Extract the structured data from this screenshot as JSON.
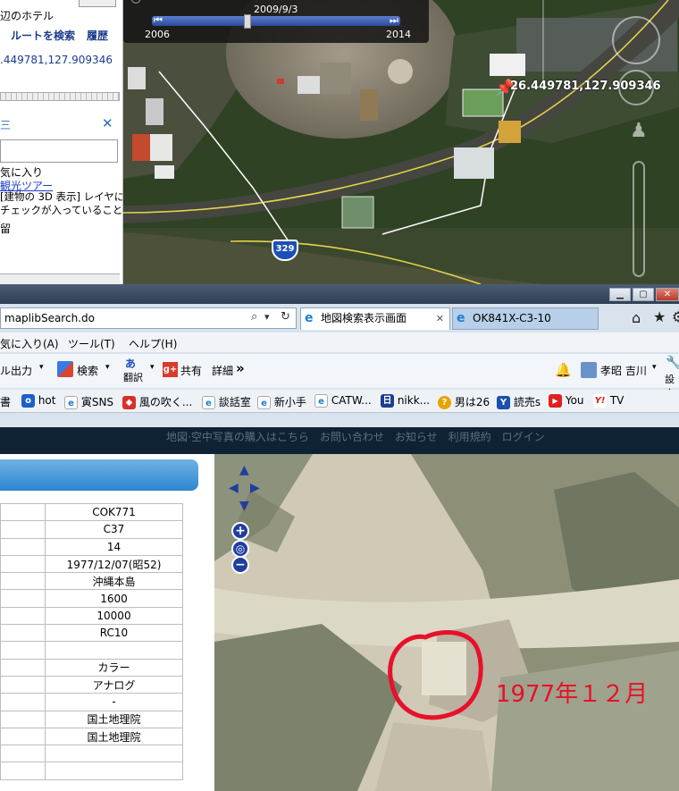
{
  "ge": {
    "sidebar_title": "辺のホテル",
    "route_search": "ルートを検索",
    "history": "履歴",
    "coords_text": ".449781,127.909346",
    "layers_heading": "気に入り",
    "tour_link": "観光ツアー",
    "note_line1": "[建物の 3D 表示] レイヤに",
    "note_line2": "チェックが入っていることを",
    "note_line3": "留",
    "time_date": "2009/9/3",
    "time_start": "2006",
    "time_end": "2014",
    "placemark_label": "26.449781,127.909346",
    "route_shield": "329"
  },
  "ie": {
    "address": "maplibSearch.do",
    "tabs": [
      {
        "label": "地図検索表示画面",
        "active": true
      },
      {
        "label": "OK841X-C3-10",
        "active": false
      }
    ],
    "menu": [
      "気に入り(A)",
      "ツール(T)",
      "ヘルプ(H)"
    ],
    "cmd": {
      "output": "ル出力",
      "search": "検索",
      "translate": "翻訳",
      "share": "共有",
      "detail": "詳細",
      "more": "»",
      "user": "孝昭 吉川",
      "settings": "設定"
    },
    "favorites": [
      "書",
      "hot",
      "寅SNS",
      "風の吹く...",
      "談話室",
      "新小手",
      "CATW...",
      "nikk...",
      "男は26",
      "読売s",
      "You",
      "TV"
    ]
  },
  "site": {
    "nav_text": "地図·空中写真の購入はこちら　お問い合わせ　お知らせ　利用規約　ログイン"
  },
  "info_table": {
    "values": [
      "COK771",
      "C37",
      "14",
      "1977/12/07(昭52)",
      "沖縄本島",
      "1600",
      "10000",
      "RC10",
      "",
      "カラー",
      "アナログ",
      "-",
      "国土地理院",
      "国土地理院",
      "",
      ""
    ]
  },
  "photo": {
    "annotation": "1977年１２月",
    "annotation_color": "#e8102a"
  },
  "colors": {
    "ie_tab_active": "#ffffff",
    "ie_tab_inactive": "#b7cfe8",
    "panel_blue": "#2d86cf",
    "nav_blue": "#1e3ea0"
  }
}
